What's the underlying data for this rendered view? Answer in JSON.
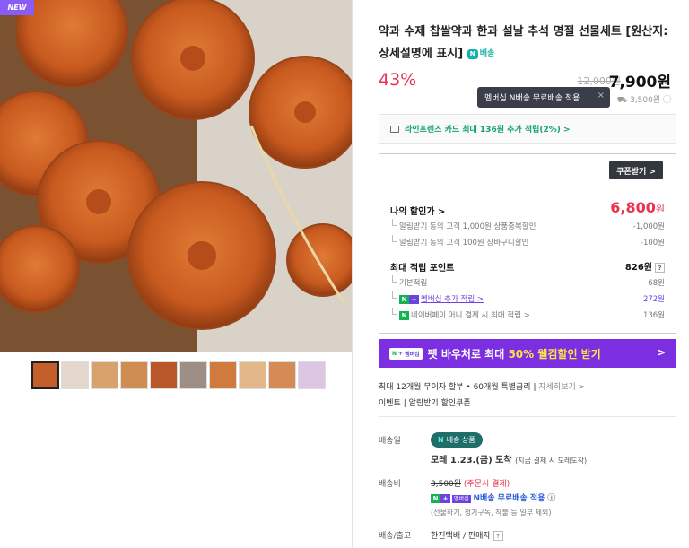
{
  "product": {
    "new_badge": "NEW",
    "title": "약과 수제 찹쌀약과 한과 설날 추석 명절 선물세트 [원산지:상세설명에 표시]",
    "npay_label": "배송",
    "discount_rate": "43%",
    "original_price": "12,000원",
    "price": "7,900원"
  },
  "tooltip": {
    "text": "멤버십 N배송 무료배송 적용",
    "close": "×"
  },
  "shipping_original": "3,500원",
  "card_promo": "라인프렌즈 카드 최대 136원 추가 적립(2%) >",
  "coupon_button": "쿠폰받기 >",
  "my_discount": {
    "label": "나의 할인가 >",
    "value": "6,800",
    "unit": "원",
    "items": [
      {
        "label": "알림받기 동의 고객 1,000원 상품중복할인",
        "value": "-1,000원"
      },
      {
        "label": "알림받기 동의 고객 100원 장바구니할인",
        "value": "-100원"
      }
    ]
  },
  "points": {
    "label": "최대 적립 포인트",
    "value": "826원",
    "q": "?",
    "items": [
      {
        "label": "기본적립",
        "value": "68원"
      },
      {
        "label": "멤버십 추가 적립 >",
        "value": "272원"
      },
      {
        "label": "네이버페이 머니 결제 시 최대 적립 >",
        "value": "136원"
      }
    ]
  },
  "banner": {
    "badge": "멤버십",
    "text_a": "펫 바우처로 최대 ",
    "text_b": "50% 웰컴할인 받기",
    "arrow": ">"
  },
  "installment": {
    "text": "최대 12개월 무이자 할부 • 60개월 특별금리",
    "link": "자세히보기 >"
  },
  "event": "이벤트 | 알림받기 할인쿠폰",
  "delivery": {
    "label": "배송일",
    "badge": "배송 상품",
    "arrival": "모레 1.23.(금) 도착",
    "arrival_note": "(지금 결제 시 모레도착)"
  },
  "fee": {
    "label": "배송비",
    "original": "3,500원",
    "note": "(주문시 결제)",
    "badge": "멤버십",
    "free_text": "N배송 무료배송 적용",
    "exception": "(선물하기, 정기구독, 착불 등 일부 제외)"
  },
  "carrier": {
    "label": "배송/출고",
    "value": "한진택배 / 판매자",
    "q": "?"
  }
}
